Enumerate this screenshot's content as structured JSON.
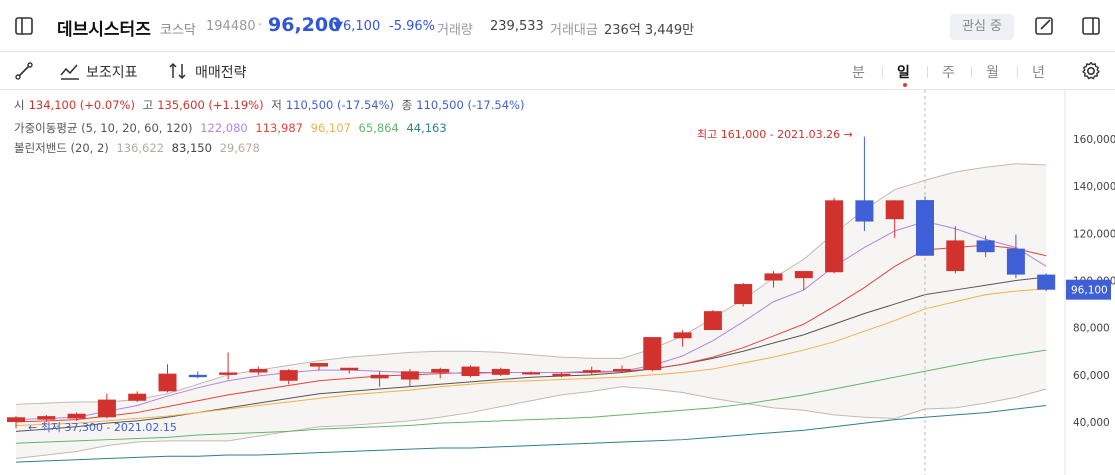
{
  "header": {
    "name": "데브시스터즈",
    "market": "코스닥",
    "code": "194480",
    "price": "96,200",
    "change": "▼6,100",
    "change_pct": "-5.96%",
    "volume_label": "거래량",
    "volume": "239,533",
    "amount_label": "거래대금",
    "amount": "236억 3,449만",
    "fav_label": "관심 중"
  },
  "toolbar": {
    "indicator_label": "보조지표",
    "strategy_label": "매매전략",
    "periods": [
      "분",
      "일",
      "주",
      "월",
      "년"
    ],
    "active_period": "일"
  },
  "legend": {
    "ohlc": {
      "open_label": "시",
      "open": "134,100 (+0.07%)",
      "high_label": "고",
      "high": "135,600 (+1.19%)",
      "low_label": "저",
      "low": "110,500 (-17.54%)",
      "close_label": "종",
      "close": "110,500 (-17.54%)"
    },
    "ma": {
      "label": "가중이동평균 (5, 10, 20, 60, 120)",
      "values": [
        "122,080",
        "113,987",
        "96,107",
        "65,864",
        "44,163"
      ]
    },
    "bb": {
      "label": "볼린저밴드 (20, 2)",
      "values": [
        "136,622",
        "83,150",
        "29,678"
      ]
    }
  },
  "colors": {
    "up": "#d1322e",
    "down": "#3f5fd6",
    "ma5": "#b285e0",
    "ma10": "#e8443a",
    "ma20": "#f0b14a",
    "ma60": "#62b56a",
    "ma120": "#2f7f8a",
    "bb_band": "#c5b8b0",
    "bb_mid": "#555555"
  },
  "chart_data": {
    "type": "candlestick",
    "y_ticks": [
      "160,000",
      "140,000",
      "120,000",
      "100,000",
      "80,000",
      "60,000",
      "40,000"
    ],
    "y_tick_values": [
      160000,
      140000,
      120000,
      100000,
      80000,
      60000,
      40000
    ],
    "ylim": [
      20000,
      175000
    ],
    "current_price_label": "96,100",
    "current_price": 96100,
    "max_annotation": "최고 161,000 - 2021.03.26 →",
    "min_annotation": "← 최저 37,300 - 2021.02.15",
    "candles": [
      {
        "o": 40000,
        "h": 42500,
        "l": 37300,
        "c": 42000
      },
      {
        "o": 41000,
        "h": 43000,
        "l": 40000,
        "c": 42500
      },
      {
        "o": 41500,
        "h": 44000,
        "l": 40500,
        "c": 43500
      },
      {
        "o": 42000,
        "h": 52000,
        "l": 41500,
        "c": 49500
      },
      {
        "o": 49000,
        "h": 53000,
        "l": 48500,
        "c": 52000
      },
      {
        "o": 53000,
        "h": 64500,
        "l": 52500,
        "c": 60500
      },
      {
        "o": 60000,
        "h": 61500,
        "l": 58500,
        "c": 59000
      },
      {
        "o": 60000,
        "h": 69500,
        "l": 58000,
        "c": 61000
      },
      {
        "o": 61000,
        "h": 63500,
        "l": 60000,
        "c": 62500
      },
      {
        "o": 57500,
        "h": 62500,
        "l": 56000,
        "c": 62000
      },
      {
        "o": 63500,
        "h": 65000,
        "l": 62000,
        "c": 65000
      },
      {
        "o": 62000,
        "h": 63000,
        "l": 60500,
        "c": 63000
      },
      {
        "o": 58500,
        "h": 61500,
        "l": 55000,
        "c": 60000
      },
      {
        "o": 58000,
        "h": 62500,
        "l": 55000,
        "c": 61500
      },
      {
        "o": 61000,
        "h": 63000,
        "l": 58500,
        "c": 62500
      },
      {
        "o": 59500,
        "h": 64000,
        "l": 59000,
        "c": 63500
      },
      {
        "o": 60000,
        "h": 63000,
        "l": 59500,
        "c": 62500
      },
      {
        "o": 60500,
        "h": 61500,
        "l": 60000,
        "c": 61000
      },
      {
        "o": 59500,
        "h": 61000,
        "l": 59000,
        "c": 60500
      },
      {
        "o": 61500,
        "h": 63500,
        "l": 60000,
        "c": 62000
      },
      {
        "o": 61500,
        "h": 64000,
        "l": 61000,
        "c": 62500
      },
      {
        "o": 62000,
        "h": 76000,
        "l": 61500,
        "c": 76000
      },
      {
        "o": 75500,
        "h": 79000,
        "l": 72000,
        "c": 78000
      },
      {
        "o": 79000,
        "h": 87500,
        "l": 79000,
        "c": 87000
      },
      {
        "o": 90000,
        "h": 99000,
        "l": 89000,
        "c": 98500
      },
      {
        "o": 100000,
        "h": 104000,
        "l": 97000,
        "c": 103000
      },
      {
        "o": 101000,
        "h": 103000,
        "l": 96000,
        "c": 104000
      },
      {
        "o": 103500,
        "h": 135000,
        "l": 103000,
        "c": 134000
      },
      {
        "o": 134000,
        "h": 161000,
        "l": 121000,
        "c": 125000
      },
      {
        "o": 126000,
        "h": 134000,
        "l": 118000,
        "c": 134000
      },
      {
        "o": 134100,
        "h": 135600,
        "l": 110500,
        "c": 110500
      },
      {
        "o": 104000,
        "h": 123000,
        "l": 103000,
        "c": 117000
      },
      {
        "o": 117000,
        "h": 119000,
        "l": 110000,
        "c": 112000
      },
      {
        "o": 113500,
        "h": 119500,
        "l": 101000,
        "c": 102500
      },
      {
        "o": 102500,
        "h": 103000,
        "l": 95500,
        "c": 96100
      }
    ],
    "ma5": [
      41000,
      41500,
      42000,
      44500,
      47000,
      51000,
      54500,
      57500,
      59500,
      61000,
      62000,
      62000,
      61500,
      61000,
      61000,
      60500,
      61000,
      61000,
      61000,
      61500,
      61500,
      64000,
      68000,
      74500,
      82500,
      91000,
      96000,
      106000,
      114000,
      121000,
      125000,
      122000,
      117500,
      114000,
      106000
    ],
    "ma10": [
      40000,
      40500,
      41000,
      42500,
      44000,
      46500,
      49000,
      51500,
      53500,
      55500,
      57500,
      58500,
      59500,
      60000,
      60500,
      61000,
      61000,
      61000,
      61000,
      61000,
      61500,
      62500,
      64500,
      67500,
      71500,
      76500,
      81500,
      89000,
      97000,
      106000,
      113000,
      114000,
      115000,
      113500,
      110500
    ],
    "ma20": [
      38500,
      39000,
      39500,
      40500,
      41500,
      42500,
      44000,
      45500,
      47000,
      48500,
      50000,
      51500,
      52500,
      53500,
      55000,
      56000,
      57000,
      57500,
      58000,
      58500,
      59000,
      60000,
      61000,
      62500,
      65000,
      67500,
      70500,
      74000,
      78500,
      83000,
      88000,
      91000,
      94000,
      95500,
      96500
    ],
    "ma60": [
      31000,
      31500,
      32000,
      32500,
      33000,
      33500,
      34500,
      35000,
      35500,
      36000,
      37000,
      37500,
      38000,
      38500,
      39500,
      40000,
      40500,
      41000,
      41500,
      42000,
      43000,
      44000,
      45000,
      46000,
      47500,
      49500,
      51500,
      54000,
      56500,
      59000,
      61500,
      64000,
      66500,
      68500,
      70500
    ],
    "ma120": [
      23000,
      23500,
      24000,
      24500,
      25000,
      25500,
      25500,
      26000,
      26000,
      26500,
      27000,
      27500,
      28000,
      28500,
      29000,
      29000,
      29500,
      30000,
      30500,
      31000,
      31500,
      32000,
      32500,
      33500,
      34500,
      35500,
      36500,
      38000,
      39500,
      41000,
      42000,
      43000,
      44000,
      45500,
      47000
    ],
    "bb_upper": [
      47500,
      48000,
      48500,
      48500,
      49500,
      52000,
      56000,
      60000,
      62000,
      64000,
      66000,
      67500,
      68500,
      69500,
      70000,
      70000,
      69500,
      68500,
      67500,
      67000,
      67000,
      71000,
      76500,
      84000,
      92000,
      101000,
      109000,
      120000,
      130000,
      138500,
      142500,
      146000,
      148000,
      149500,
      149000
    ],
    "bb_mid": [
      36000,
      37000,
      38000,
      39500,
      40500,
      42000,
      44000,
      46000,
      48000,
      50000,
      52000,
      53000,
      54000,
      55000,
      56000,
      57000,
      58000,
      59000,
      59500,
      60000,
      61000,
      62500,
      64500,
      67000,
      70000,
      73500,
      77000,
      81500,
      86000,
      90000,
      94000,
      96000,
      98000,
      100000,
      101500
    ],
    "bb_lower": [
      24500,
      26000,
      27500,
      30000,
      31500,
      32000,
      32000,
      32000,
      34000,
      36000,
      38000,
      38500,
      39500,
      40500,
      42000,
      44000,
      46500,
      49000,
      51500,
      53000,
      55000,
      54000,
      52500,
      50000,
      48000,
      46000,
      45000,
      43000,
      42000,
      41500,
      45500,
      46000,
      48000,
      50500,
      54000
    ]
  }
}
